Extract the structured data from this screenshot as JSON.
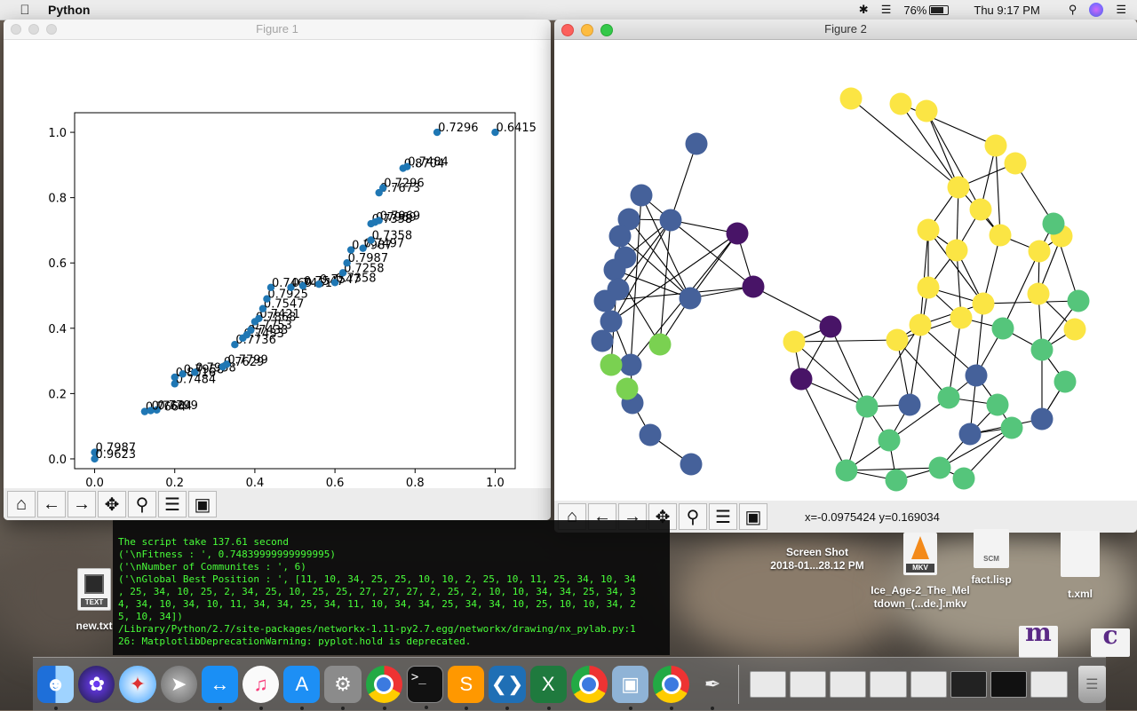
{
  "menubar": {
    "app_name": "Python",
    "battery": "76%",
    "battery_level": 0.76,
    "clock": "Thu 9:17 PM"
  },
  "figure1": {
    "title": "Figure 1",
    "toolbar": [
      "home-icon",
      "back-arrow-icon",
      "forward-arrow-icon",
      "pan-icon",
      "zoom-icon",
      "configure-icon",
      "save-icon"
    ]
  },
  "figure2": {
    "title": "Figure 2",
    "toolbar": [
      "home-icon",
      "back-arrow-icon",
      "forward-arrow-icon",
      "pan-icon",
      "zoom-icon",
      "configure-icon",
      "save-icon"
    ],
    "coords": "x=-0.0975424   y=0.169034"
  },
  "chart_data": [
    {
      "type": "scatter",
      "xlim": [
        -0.05,
        1.05
      ],
      "ylim": [
        -0.03,
        1.06
      ],
      "xticks": [
        "0.0",
        "0.2",
        "0.4",
        "0.6",
        "0.8",
        "1.0"
      ],
      "xtick_values": [
        0,
        0.2,
        0.4,
        0.6,
        0.8,
        1.0
      ],
      "yticks": [
        "0.0",
        "0.2",
        "0.4",
        "0.6",
        "0.8",
        "1.0"
      ],
      "ytick_values": [
        0,
        0.2,
        0.4,
        0.6,
        0.8,
        1.0
      ],
      "color": "#1f77b4",
      "points": [
        {
          "x": 0.0,
          "y": 0.02,
          "label": "0.7987"
        },
        {
          "x": 0.0,
          "y": 0.0,
          "label": "0.9623"
        },
        {
          "x": 0.125,
          "y": 0.145,
          "label": "0.7664"
        },
        {
          "x": 0.155,
          "y": 0.15,
          "label": "0.7799"
        },
        {
          "x": 0.14,
          "y": 0.148,
          "label": "0.7664"
        },
        {
          "x": 0.2,
          "y": 0.23,
          "label": "0.7484"
        },
        {
          "x": 0.2,
          "y": 0.25,
          "label": "0.8016"
        },
        {
          "x": 0.22,
          "y": 0.26,
          "label": "0.7958"
        },
        {
          "x": 0.25,
          "y": 0.265,
          "label": "0.7958"
        },
        {
          "x": 0.32,
          "y": 0.282,
          "label": "0.7629"
        },
        {
          "x": 0.33,
          "y": 0.29,
          "label": "0.7799"
        },
        {
          "x": 0.35,
          "y": 0.35,
          "label": "0.7736"
        },
        {
          "x": 0.37,
          "y": 0.37,
          "label": "0.7433"
        },
        {
          "x": 0.38,
          "y": 0.38,
          "label": "0.7433"
        },
        {
          "x": 0.39,
          "y": 0.395,
          "label": "0.7753"
        },
        {
          "x": 0.4,
          "y": 0.42,
          "label": "0.7868"
        },
        {
          "x": 0.41,
          "y": 0.43,
          "label": "0.7421"
        },
        {
          "x": 0.42,
          "y": 0.46,
          "label": "0.7547"
        },
        {
          "x": 0.43,
          "y": 0.49,
          "label": "0.7925"
        },
        {
          "x": 0.44,
          "y": 0.525,
          "label": "0.7469"
        },
        {
          "x": 0.49,
          "y": 0.525,
          "label": "0.7461"
        },
        {
          "x": 0.52,
          "y": 0.53,
          "label": "0.7547"
        },
        {
          "x": 0.56,
          "y": 0.535,
          "label": "0.7547"
        },
        {
          "x": 0.6,
          "y": 0.54,
          "label": "0.7358"
        },
        {
          "x": 0.62,
          "y": 0.57,
          "label": "0.7258"
        },
        {
          "x": 0.63,
          "y": 0.6,
          "label": "0.7987"
        },
        {
          "x": 0.64,
          "y": 0.64,
          "label": "0.7987"
        },
        {
          "x": 0.67,
          "y": 0.645,
          "label": "0.7497"
        },
        {
          "x": 0.69,
          "y": 0.67,
          "label": "0.7358"
        },
        {
          "x": 0.69,
          "y": 0.72,
          "label": "0.7358"
        },
        {
          "x": 0.7,
          "y": 0.725,
          "label": "0.7969"
        },
        {
          "x": 0.71,
          "y": 0.73,
          "label": "0.7969"
        },
        {
          "x": 0.71,
          "y": 0.815,
          "label": "0.7673"
        },
        {
          "x": 0.72,
          "y": 0.83,
          "label": "0.7296"
        },
        {
          "x": 0.77,
          "y": 0.89,
          "label": "0.8704"
        },
        {
          "x": 0.78,
          "y": 0.895,
          "label": "0.7484"
        },
        {
          "x": 0.855,
          "y": 1.0,
          "label": "0.7296"
        },
        {
          "x": 1.0,
          "y": 1.0,
          "label": "0.6415"
        }
      ]
    },
    {
      "type": "network",
      "palette": {
        "purple": "#440154",
        "blue": "#3b528b",
        "green": "#5ec962",
        "teal": "#21918c",
        "lightgreen": "#5cc863",
        "yellow": "#fde725"
      },
      "node_colors": {
        "dark": "#481467",
        "blue": "#45619a",
        "green": "#55c57b",
        "lime": "#7ad151",
        "yellow": "#fbe544"
      }
    }
  ],
  "terminal": {
    "lines": [
      "The script take 137.61 second",
      "('\\nFitness : ', 0.74839999999999995)",
      "('\\nNumber of Communites : ', 6)",
      "('\\nGlobal Best Position : ', [11, 10, 34, 25, 25, 10, 10, 2, 25, 10, 11, 25, 34, 10, 34",
      ", 25, 34, 10, 25, 2, 34, 25, 10, 25, 25, 27, 27, 27, 2, 25, 2, 10, 10, 34, 34, 25, 34, 3",
      "4, 34, 10, 34, 10, 11, 34, 34, 25, 34, 11, 10, 34, 34, 25, 34, 34, 10, 25, 10, 10, 34, 2",
      "5, 10, 34])",
      "/Library/Python/2.7/site-packages/networkx-1.11-py2.7.egg/networkx/drawing/nx_pylab.py:1",
      "26: MatplotlibDeprecationWarning: pyplot.hold is deprecated."
    ]
  },
  "desktop": {
    "newtxt": "new.txt",
    "text_badge": "TEXT",
    "screenshot_l1": "Screen Shot",
    "screenshot_l2": "2018-01...28.12 PM",
    "mkv_badge": "MKV",
    "mkv_l1": "Ice_Age-2_The_Mel",
    "mkv_l2": "tdown_(...de.].mkv",
    "scm_badge": "SCM",
    "factlisp": "fact.lisp",
    "txml": "t.xml"
  }
}
